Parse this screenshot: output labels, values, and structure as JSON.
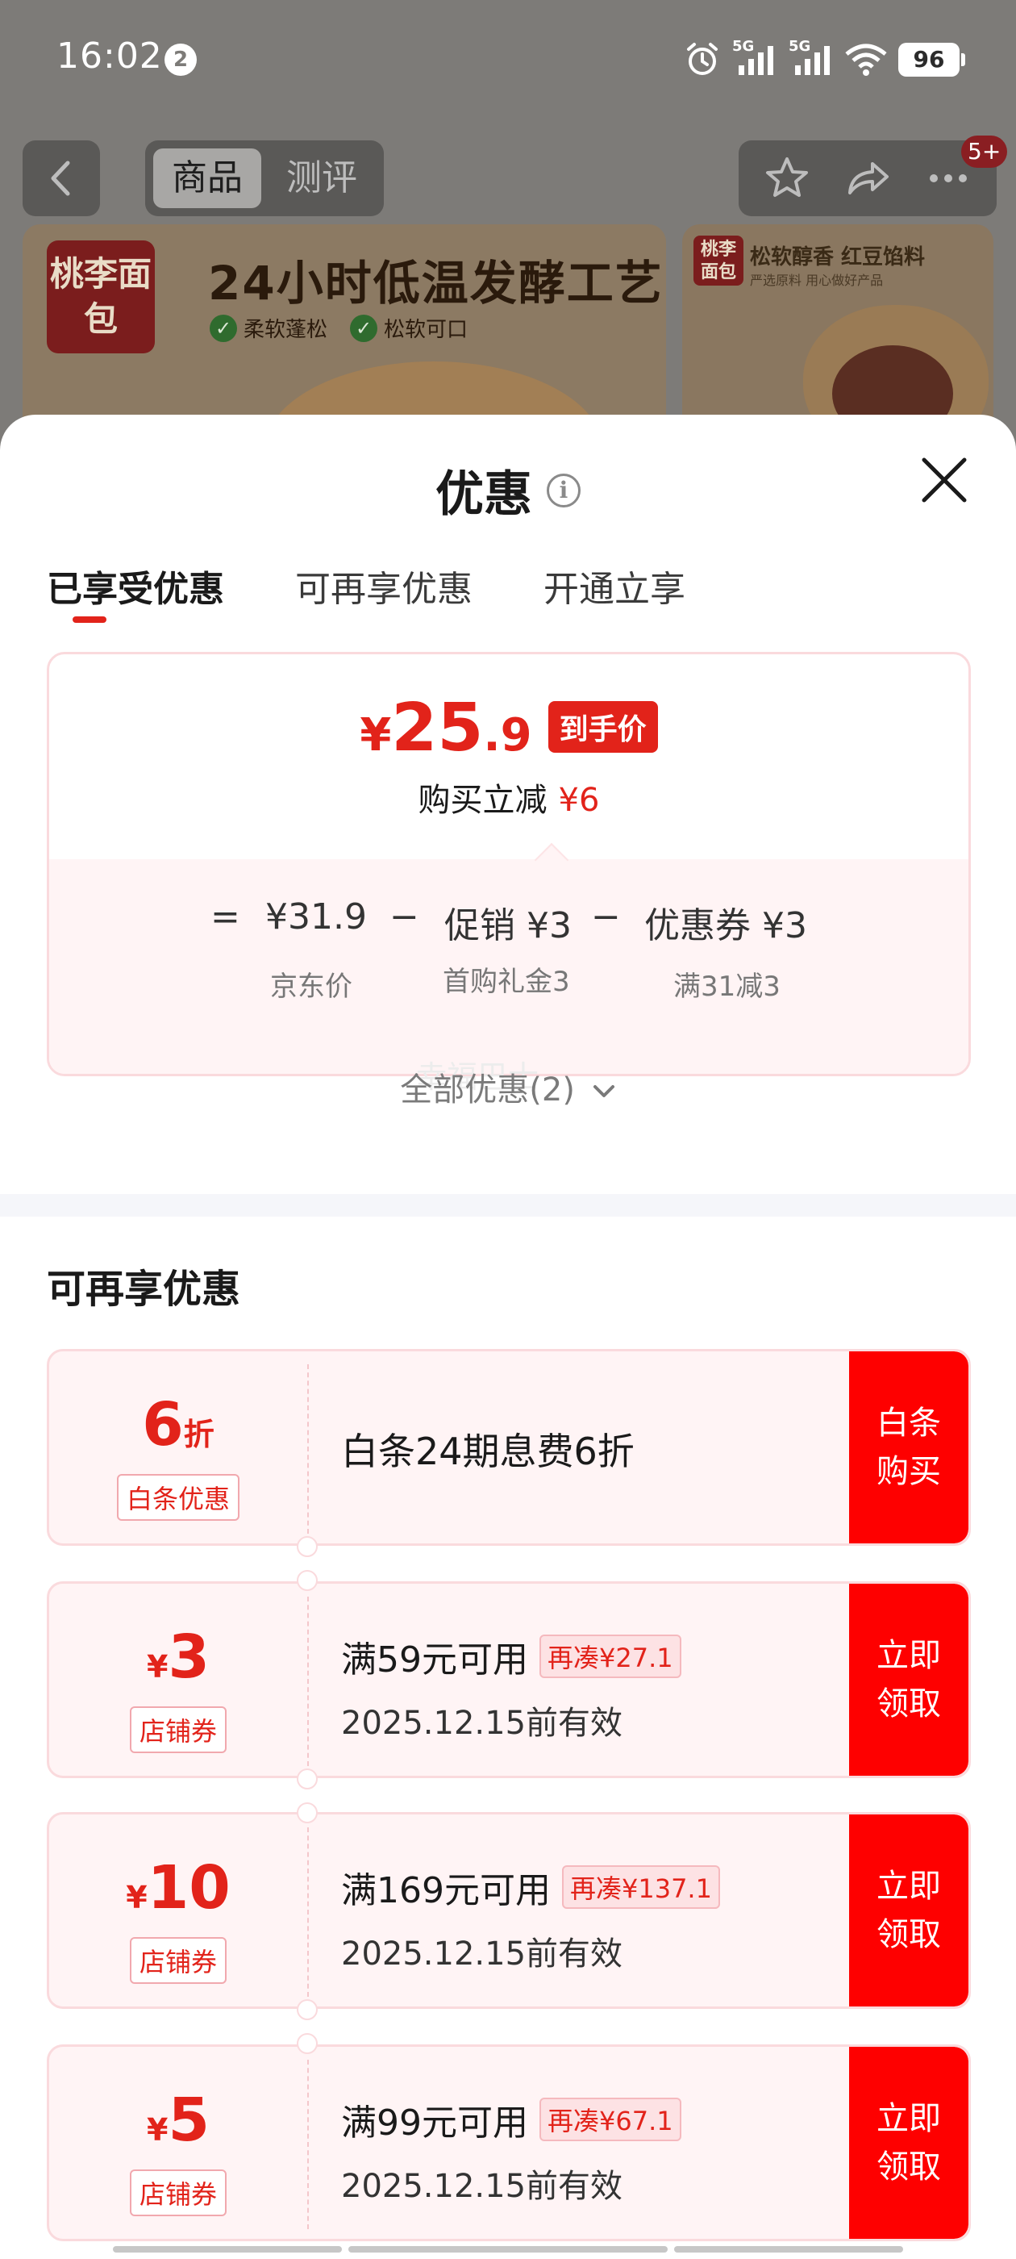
{
  "status_bar": {
    "time": "16:02",
    "notification_count": "2",
    "network_label_1": "5G",
    "network_label_2": "5G",
    "battery": "96",
    "icons": [
      "alarm-icon",
      "signal-icon",
      "signal-icon",
      "wifi-icon",
      "battery-icon"
    ]
  },
  "nav": {
    "tabs": [
      {
        "label": "商品"
      },
      {
        "label": "测评"
      }
    ],
    "badge": "5+",
    "icons": [
      "back-icon",
      "star-icon",
      "share-icon",
      "more-icon"
    ]
  },
  "banner": {
    "logo": "桃李面包",
    "title": "24小时低温发酵工艺",
    "tags": [
      "柔软蓬松",
      "松软可口"
    ],
    "side_logo": "桃李面包",
    "side_title": "松软醇香 红豆馅料",
    "side_sub": "严选原料 用心做好产品"
  },
  "sheet": {
    "title": "优惠",
    "tabs": [
      {
        "label": "已享受优惠"
      },
      {
        "label": "可再享优惠"
      },
      {
        "label": "开通立享"
      }
    ],
    "final_price": {
      "currency": "¥",
      "integer": "25",
      "decimal": ".9",
      "badge": "到手价"
    },
    "save": {
      "label": "购买立减",
      "amount": "¥6"
    },
    "formula": {
      "equals": "=",
      "minus": "−",
      "items": [
        {
          "value": "¥31.9",
          "label": "京东价"
        },
        {
          "value": "促销 ¥3",
          "label": "首购礼金3"
        },
        {
          "value": "优惠券 ¥3",
          "label": "满31减3"
        }
      ]
    },
    "ghost_text": "幸福巴士",
    "all_discounts": "全部优惠(2)",
    "section_title": "可再享优惠",
    "coupons": [
      {
        "value_big": "6",
        "value_small": "折",
        "tag": "白条优惠",
        "desc": "白条24期息费6折",
        "btn_line1": "白条",
        "btn_line2": "购买"
      },
      {
        "value_small": "¥",
        "value_big": "3",
        "tag": "店铺券",
        "cond": "满59元可用",
        "extra": "再凑¥27.1",
        "date": "2025.12.15前有效",
        "btn_line1": "立即",
        "btn_line2": "领取"
      },
      {
        "value_small": "¥",
        "value_big": "10",
        "tag": "店铺券",
        "cond": "满169元可用",
        "extra": "再凑¥137.1",
        "date": "2025.12.15前有效",
        "btn_line1": "立即",
        "btn_line2": "领取"
      },
      {
        "value_small": "¥",
        "value_big": "5",
        "tag": "店铺券",
        "cond": "满99元可用",
        "extra": "再凑¥67.1",
        "date": "2025.12.15前有效",
        "btn_line1": "立即",
        "btn_line2": "领取"
      }
    ]
  },
  "colors": {
    "accent_red": "#e2231a",
    "button_red": "#fe0000",
    "coupon_bg": "#fff4f5",
    "coupon_border": "#fadadd"
  }
}
